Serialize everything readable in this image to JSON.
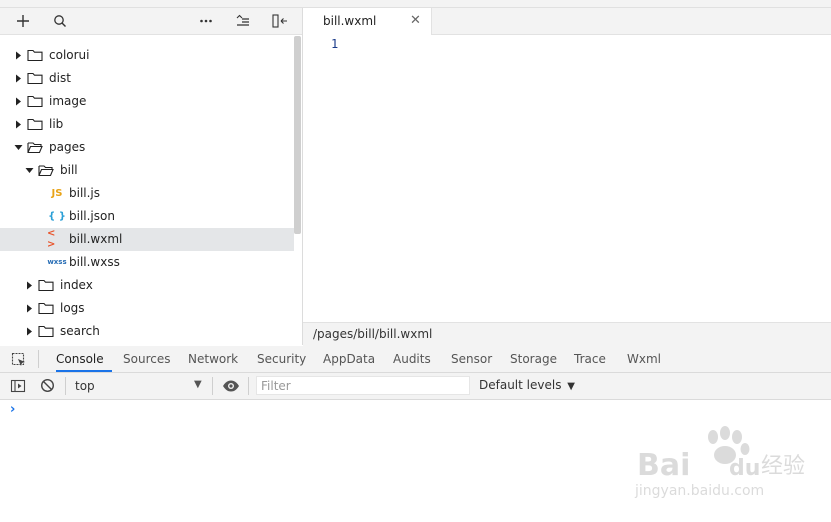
{
  "explorer": {
    "toolbar": {
      "add_icon": "plus-icon",
      "search_icon": "search-icon",
      "more_icon": "more-horizontal-icon",
      "sort_icon": "sort-icon",
      "collapse_icon": "collapse-icon"
    },
    "tree": [
      {
        "label": "colorui",
        "type": "folder",
        "expanded": false,
        "depth": 0
      },
      {
        "label": "dist",
        "type": "folder",
        "expanded": false,
        "depth": 0
      },
      {
        "label": "image",
        "type": "folder",
        "expanded": false,
        "depth": 0
      },
      {
        "label": "lib",
        "type": "folder",
        "expanded": false,
        "depth": 0
      },
      {
        "label": "pages",
        "type": "folder",
        "expanded": true,
        "depth": 0
      },
      {
        "label": "bill",
        "type": "folder",
        "expanded": true,
        "depth": 1
      },
      {
        "label": "bill.js",
        "type": "js",
        "icon_text": "JS",
        "depth": 2
      },
      {
        "label": "bill.json",
        "type": "json",
        "icon_text": "{ }",
        "depth": 2
      },
      {
        "label": "bill.wxml",
        "type": "wxml",
        "icon_text": "< >",
        "depth": 2,
        "selected": true
      },
      {
        "label": "bill.wxss",
        "type": "wxss",
        "icon_text": "wxss",
        "depth": 2
      },
      {
        "label": "index",
        "type": "folder",
        "expanded": false,
        "depth": 1
      },
      {
        "label": "logs",
        "type": "folder",
        "expanded": false,
        "depth": 1
      },
      {
        "label": "search",
        "type": "folder",
        "expanded": false,
        "depth": 1
      }
    ]
  },
  "editor": {
    "tab": {
      "label": "bill.wxml",
      "close": "✕"
    },
    "line_numbers": [
      "1"
    ],
    "status_path": "/pages/bill/bill.wxml"
  },
  "devtools": {
    "tabs": [
      "Console",
      "Sources",
      "Network",
      "Security",
      "AppData",
      "Audits",
      "Sensor",
      "Storage",
      "Trace",
      "Wxml"
    ],
    "active_tab": "Console",
    "console": {
      "context": "top",
      "filter_placeholder": "Filter",
      "levels": "Default levels",
      "prompt": "›"
    }
  },
  "watermark": {
    "brand": "Bai",
    "brand2": "du",
    "cn": "经验",
    "url": "jingyan.baidu.com"
  },
  "colors": {
    "accent": "#1a73e8",
    "js_icon": "#e8a317",
    "json_icon": "#2a9fd6",
    "wxml_icon": "#e8542b",
    "wxss_icon": "#2a6fb6",
    "selected_row": "#e4e6e8"
  }
}
